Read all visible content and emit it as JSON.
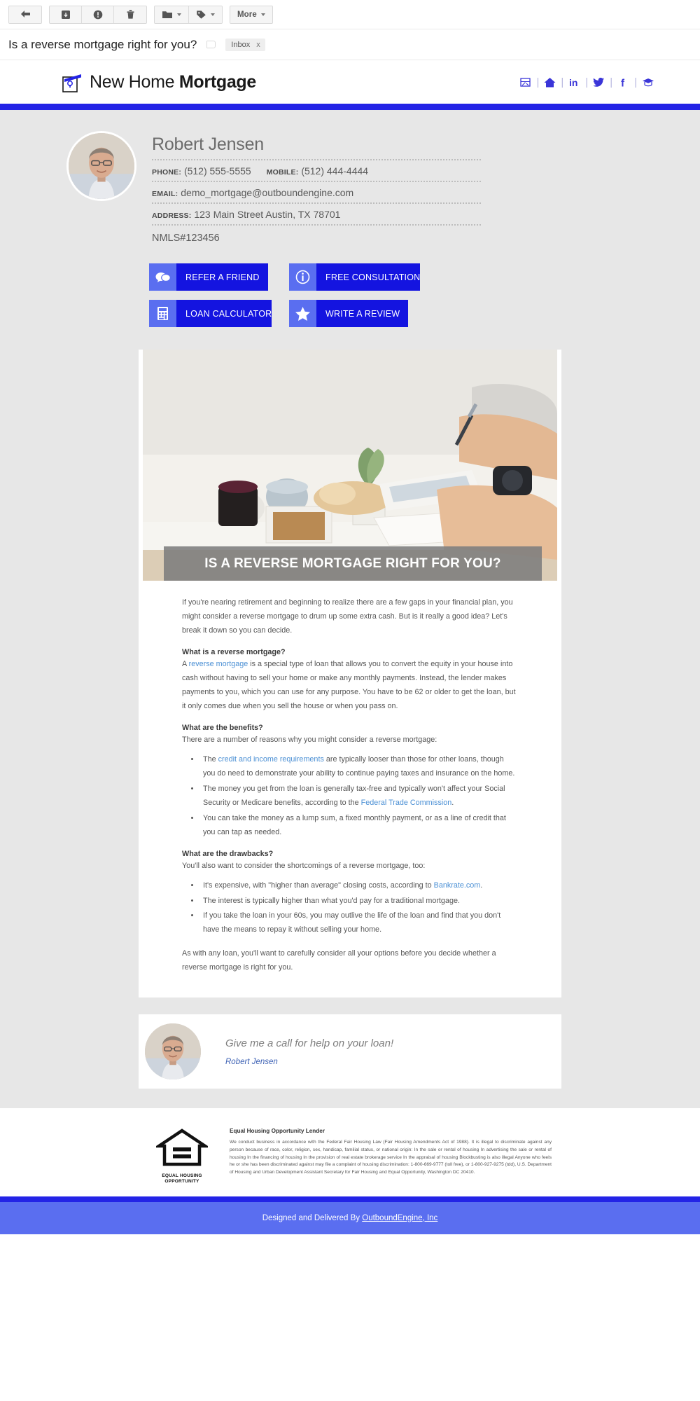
{
  "toolbar": {
    "groups": [
      {
        "buttons": [
          {
            "name": "back-button",
            "icon": "back-arrow-icon",
            "label": ""
          }
        ]
      },
      {
        "buttons": [
          {
            "name": "archive-button",
            "icon": "archive-icon",
            "label": ""
          },
          {
            "name": "spam-button",
            "icon": "exclamation-icon",
            "label": ""
          },
          {
            "name": "delete-button",
            "icon": "trash-icon",
            "label": ""
          }
        ]
      },
      {
        "buttons": [
          {
            "name": "move-to-button",
            "icon": "folder-icon",
            "label": ""
          },
          {
            "name": "labels-button",
            "icon": "tag-icon",
            "label": ""
          }
        ]
      },
      {
        "buttons": [
          {
            "name": "more-button",
            "icon": "",
            "label": "More"
          }
        ]
      }
    ],
    "more_label": "More"
  },
  "subject": {
    "text": "Is a reverse mortgage right for you?",
    "label_chip": "Inbox",
    "label_remove": "x"
  },
  "brand": {
    "logo_light": "New Home ",
    "logo_bold": "Mortgage",
    "socials": [
      {
        "name": "social-email-icon",
        "glyph": "email"
      },
      {
        "name": "social-home-icon",
        "glyph": "home"
      },
      {
        "name": "social-linkedin-icon",
        "glyph": "in"
      },
      {
        "name": "social-twitter-icon",
        "glyph": "twitter"
      },
      {
        "name": "social-facebook-icon",
        "glyph": "f"
      },
      {
        "name": "social-graduation-icon",
        "glyph": "cap"
      }
    ],
    "accent_color": "#2323e6"
  },
  "signature": {
    "name": "Robert Jensen",
    "phone_label": "PHONE:",
    "phone": "(512) 555-5555",
    "mobile_label": "MOBILE:",
    "mobile": "(512) 444-4444",
    "email_label": "EMAIL:",
    "email": "demo_mortgage@outboundengine.com",
    "address_label": "ADDRESS:",
    "address": "123 Main Street  Austin, TX  78701",
    "nmls": "NMLS#123456"
  },
  "ctas": [
    {
      "name": "refer-a-friend-button",
      "label": "REFER A FRIEND",
      "icon": "chat-bubbles-icon"
    },
    {
      "name": "free-consultation-button",
      "label": "FREE CONSULTATION",
      "icon": "info-icon"
    },
    {
      "name": "loan-calculator-button",
      "label": "LOAN CALCULATOR",
      "icon": "calculator-icon"
    },
    {
      "name": "write-a-review-button",
      "label": "WRITE A REVIEW",
      "icon": "star-icon"
    }
  ],
  "article": {
    "hero_title": "IS A REVERSE MORTGAGE RIGHT FOR YOU?",
    "intro": "If you're nearing retirement and beginning to realize there are a few gaps in your financial plan, you might consider a reverse mortgage to drum up some extra cash. But is it really a good idea? Let's break it down so you can decide.",
    "h1": "What is a reverse mortgage?",
    "p1_a": "A ",
    "p1_link": "reverse mortgage",
    "p1_b": " is a special type of loan that allows you to convert the equity in your house into cash without having to sell your home or make any monthly payments. Instead, the lender makes payments to you, which you can use for any purpose. You have to be 62 or older to get the loan, but it only comes due when you sell the house or when you pass on.",
    "h2": "What are the benefits?",
    "p2": "There are a number of reasons why you might consider a reverse mortgage:",
    "benefit1_a": "The ",
    "benefit1_link": "credit and income requirements",
    "benefit1_b": " are typically looser than those for other loans, though you do need to demonstrate your ability to continue paying taxes and insurance on the home.",
    "benefit2_a": "The money you get from the loan is generally tax-free and typically won't affect your Social Security or Medicare benefits, according to the ",
    "benefit2_link": "Federal Trade Commission",
    "benefit2_b": ".",
    "benefit3": "You can take the money as a lump sum, a fixed monthly payment, or as a line of credit that you can tap as needed.",
    "h3": "What are the drawbacks?",
    "p3": "You'll also want to consider the shortcomings of a reverse mortgage, too:",
    "drawback1_a": "It's expensive, with \"higher than average\" closing costs, according to ",
    "drawback1_link": "Bankrate.com",
    "drawback1_b": ".",
    "drawback2": "The interest is typically higher than what you'd pay for a traditional mortgage.",
    "drawback3": "If you take the loan in your 60s, you may outlive the life of the loan and find that you don't have the means to repay it without selling your home.",
    "closing": "As with any loan, you'll want to carefully consider all your options before you decide whether a reverse mortgage is right for you."
  },
  "closing_card": {
    "message": "Give me a call for help on your loan!",
    "signature": "Robert Jensen"
  },
  "footer": {
    "ehl_line1": "EQUAL HOUSING",
    "ehl_line2": "OPPORTUNITY",
    "legal_heading": "Equal Housing Opportunity Lender",
    "legal_body": "We conduct business in accordance with the Federal Fair Housing Law (Fair Housing Amendments Act of 1988). It is illegal to discriminate against any person because of race, color, religion, sex, handicap, familial status, or national origin: In the sale or rental of housing In advertising the sale or rental of housing In the financing of housing In the provision of real estate brokerage service In the appraisal of housing Blockbusting is also illegal Anyone who feels he or she has been discriminated against may file a complaint of housing discrimination: 1-800-669-9777 (toll free), or 1-800-927-9275 (tdd), U.S. Department of Housing and Urban Development Assistant Secretary for Fair Housing and Equal Opportunity, Washington DC 20410.",
    "credit_prefix": "Designed and Delivered By ",
    "credit_link": "OutboundEngine, Inc"
  }
}
